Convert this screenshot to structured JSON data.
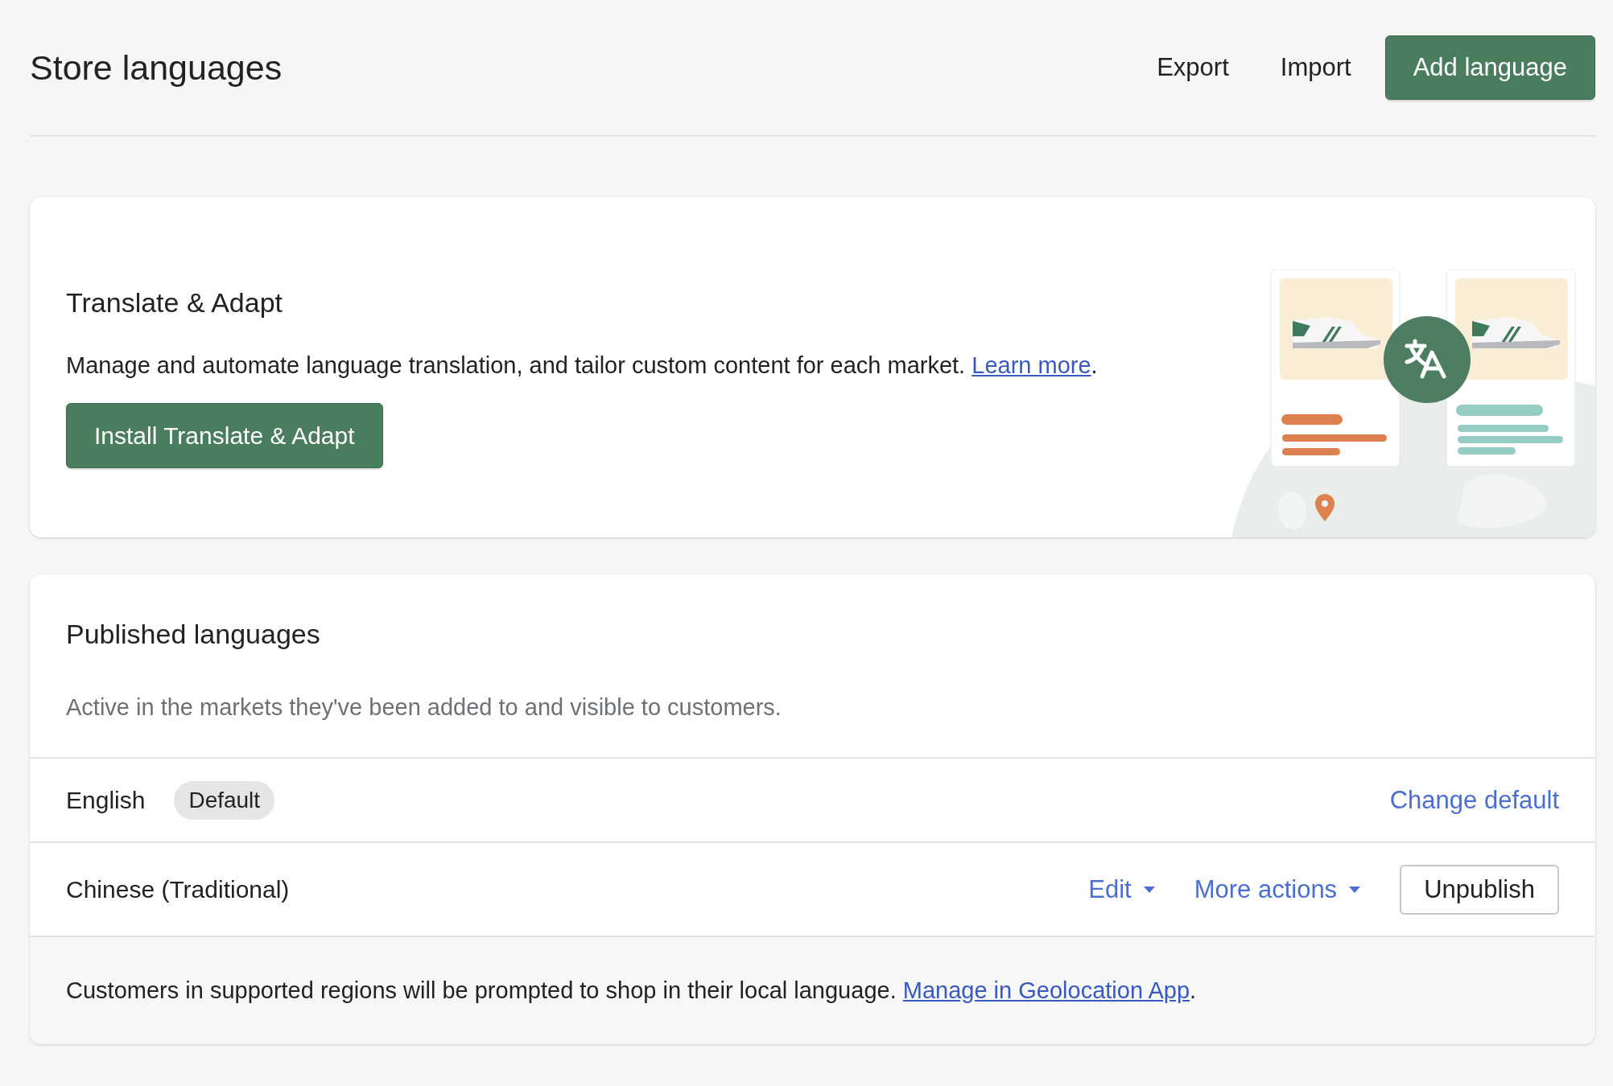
{
  "header": {
    "title": "Store languages",
    "actions": [
      "Export",
      "Import"
    ],
    "primary_action": "Add language"
  },
  "promo": {
    "title": "Translate & Adapt",
    "description": "Manage and automate language translation, and tailor custom content for each market. ",
    "link": "Learn more",
    "trailing": ".",
    "button": "Install Translate & Adapt"
  },
  "published": {
    "title": "Published languages",
    "description": "Active in the markets they've been added to and visible to customers.",
    "languages": [
      {
        "name": "English",
        "badge": "Default",
        "actions": [
          {
            "label": "Change default",
            "kind": "link"
          }
        ]
      },
      {
        "name": "Chinese (Traditional)",
        "actions": [
          {
            "label": "Edit",
            "kind": "menu"
          },
          {
            "label": "More actions",
            "kind": "menu"
          },
          {
            "label": "Unpublish",
            "kind": "button"
          }
        ]
      }
    ],
    "footer": {
      "text": "Customers in supported regions will be prompted to shop in their local language. ",
      "link": "Manage in Geolocation App",
      "trailing": "."
    }
  }
}
